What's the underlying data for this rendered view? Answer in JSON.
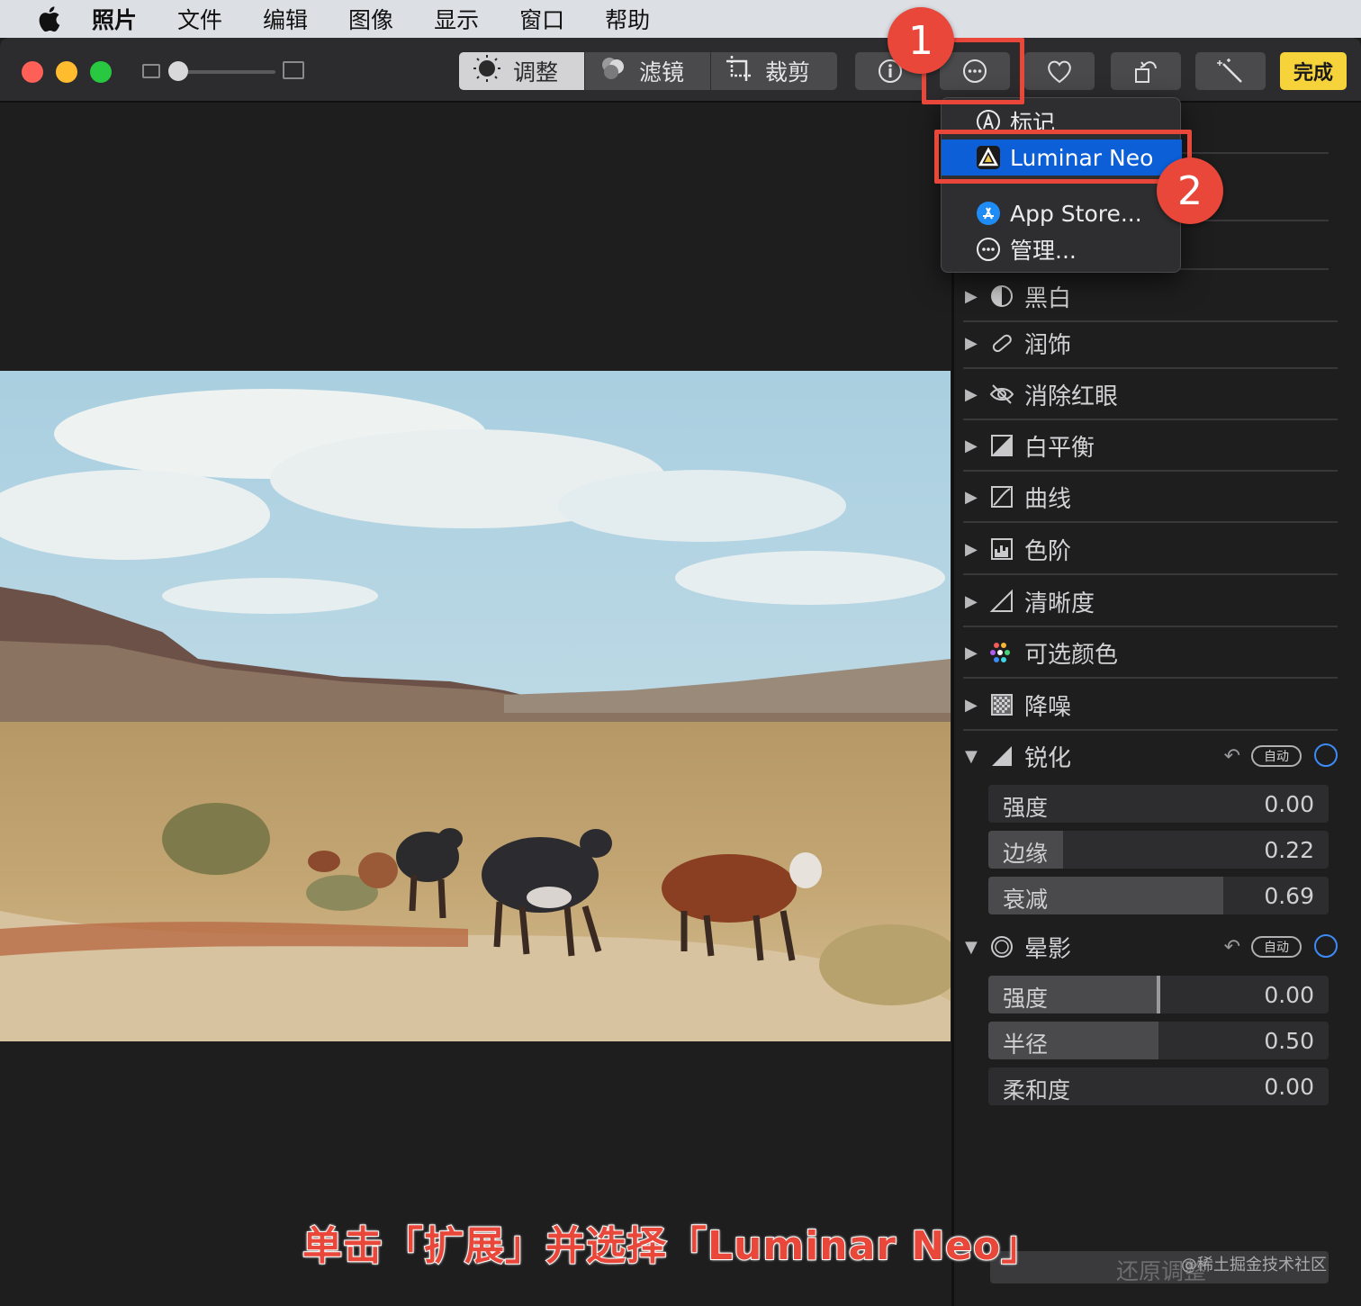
{
  "menubar": {
    "items": [
      "照片",
      "文件",
      "编辑",
      "图像",
      "显示",
      "窗口",
      "帮助"
    ]
  },
  "toolbar": {
    "tabs": [
      {
        "label": "调整",
        "icon": "adjust-dial-icon",
        "active": true
      },
      {
        "label": "滤镜",
        "icon": "filter-circles-icon",
        "active": false
      },
      {
        "label": "裁剪",
        "icon": "crop-icon",
        "active": false
      }
    ],
    "done_label": "完成"
  },
  "annotations": {
    "badge1": "1",
    "badge2": "2",
    "caption": "单击「扩展」并选择「Luminar Neo」"
  },
  "dropdown": {
    "items": [
      {
        "label": "标记",
        "icon": "markup-icon"
      },
      {
        "label": "Luminar Neo",
        "icon": "luminar-neo-icon",
        "selected": true
      },
      {
        "label": "App Store...",
        "icon": "app-store-icon"
      },
      {
        "label": "管理...",
        "icon": "more-circle-icon"
      }
    ]
  },
  "sidebar": {
    "sections": [
      {
        "label": "黑白",
        "icon": "half-circle-icon",
        "expanded": false
      },
      {
        "label": "润饰",
        "icon": "bandage-icon",
        "expanded": false
      },
      {
        "label": "消除红眼",
        "icon": "eye-slash-icon",
        "expanded": false
      },
      {
        "label": "白平衡",
        "icon": "white-balance-icon",
        "expanded": false
      },
      {
        "label": "曲线",
        "icon": "curves-icon",
        "expanded": false
      },
      {
        "label": "色阶",
        "icon": "levels-icon",
        "expanded": false
      },
      {
        "label": "清晰度",
        "icon": "definition-icon",
        "expanded": false
      },
      {
        "label": "可选颜色",
        "icon": "selective-color-icon",
        "expanded": false
      },
      {
        "label": "降噪",
        "icon": "noise-reduction-icon",
        "expanded": false
      }
    ],
    "sharpen": {
      "label": "锐化",
      "auto_label": "自动",
      "sliders": [
        {
          "label": "强度",
          "value": "0.00",
          "fill": 0.0
        },
        {
          "label": "边缘",
          "value": "0.22",
          "fill": 0.22
        },
        {
          "label": "衰减",
          "value": "0.69",
          "fill": 0.69
        }
      ]
    },
    "vignette": {
      "label": "晕影",
      "auto_label": "自动",
      "sliders": [
        {
          "label": "强度",
          "value": "0.00",
          "fill": 0.5,
          "center_mark": true
        },
        {
          "label": "半径",
          "value": "0.50",
          "fill": 0.5
        },
        {
          "label": "柔和度",
          "value": "0.00",
          "fill": 0.0
        }
      ]
    },
    "revert_label": "还原调整",
    "watermark": "@稀土掘金技术社区"
  }
}
